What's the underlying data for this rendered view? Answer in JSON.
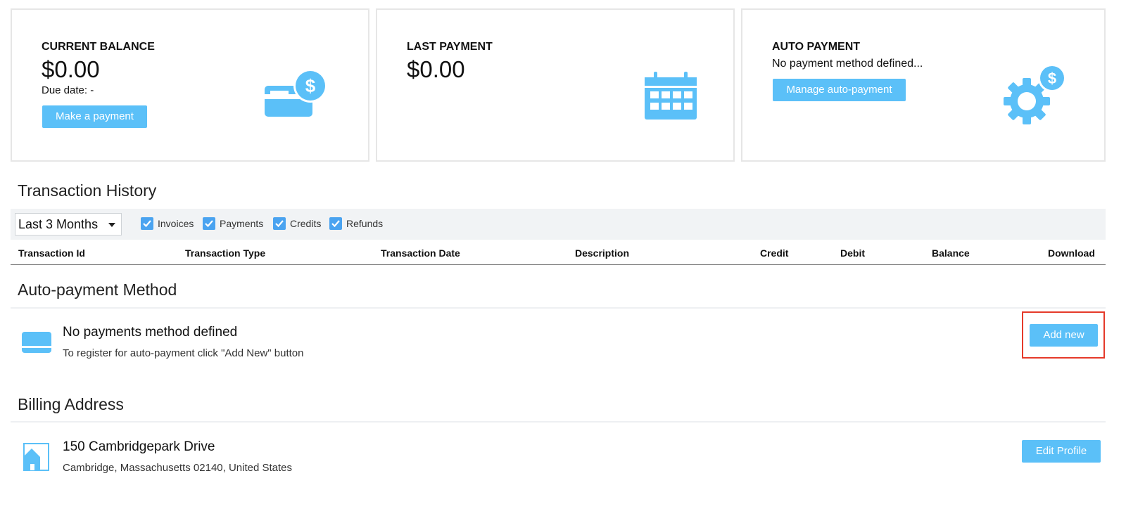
{
  "cards": {
    "current_balance": {
      "label": "CURRENT BALANCE",
      "amount": "$0.00",
      "due_date": "Due date: -",
      "button": "Make a payment",
      "icon": "credit-card-dollar-icon"
    },
    "last_payment": {
      "label": "LAST PAYMENT",
      "amount": "$0.00",
      "icon": "calendar-icon"
    },
    "auto_payment": {
      "label": "AUTO PAYMENT",
      "status": "No payment method defined...",
      "button": "Manage auto-payment",
      "icon": "gear-dollar-icon"
    }
  },
  "transaction_history": {
    "title": "Transaction History",
    "period_select": "Last 3 Months",
    "filters": [
      {
        "label": "Invoices",
        "checked": true
      },
      {
        "label": "Payments",
        "checked": true
      },
      {
        "label": "Credits",
        "checked": true
      },
      {
        "label": "Refunds",
        "checked": true
      }
    ],
    "columns": [
      "Transaction Id",
      "Transaction Type",
      "Transaction Date",
      "Description",
      "Credit",
      "Debit",
      "Balance",
      "Download"
    ]
  },
  "auto_payment_method": {
    "title": "Auto-payment Method",
    "message": "No payments method defined",
    "hint": "To register for auto-payment click \"Add New\" button",
    "button": "Add new",
    "icon": "credit-card-icon"
  },
  "billing_address": {
    "title": "Billing Address",
    "street": "150 Cambridgepark Drive",
    "city_line": "Cambridge, Massachusetts 02140, United States",
    "button": "Edit Profile",
    "icon": "house-icon"
  },
  "colors": {
    "accent": "#5bc0f8",
    "checkbox": "#4aa3f0",
    "highlight": "#e53a2a"
  }
}
